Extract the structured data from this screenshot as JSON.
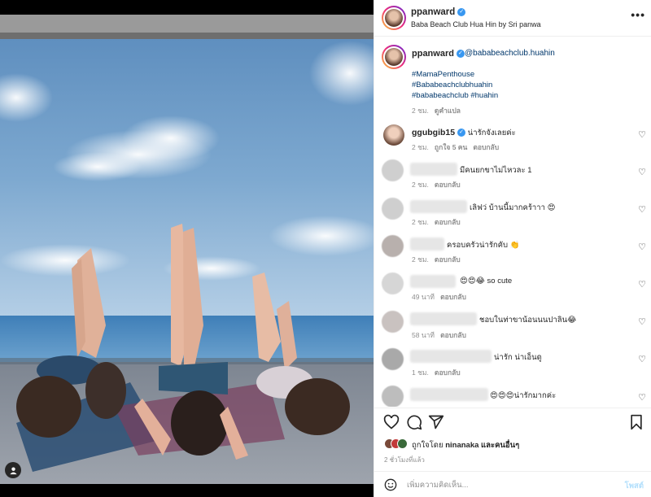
{
  "header": {
    "username": "ppanward",
    "location": "Baba Beach Club Hua Hin by Sri panwa",
    "more_label": "•••"
  },
  "caption": {
    "username": "ppanward",
    "mention": "@bababeachclub.huahin",
    "hashtags": [
      "#MamaPenthouse",
      "#Bababeachclubhuahin",
      "#bababeachclub #huahin"
    ],
    "time": "2 ชม.",
    "translate": "ดูคำแปล"
  },
  "comments": [
    {
      "username": "ggubgib15",
      "text": "น่ารักจังเลยค่ะ",
      "time": "2 ชม.",
      "likes": "ถูกใจ 5 คน",
      "reply": "ตอบกลับ"
    },
    {
      "username": "",
      "text": "มีคนยกขาไม่ไหวละ 1",
      "time": "2 ชม.",
      "reply": "ตอบกลับ"
    },
    {
      "username": "",
      "text": "เลิฟว่ บ้านนี้มากคร้าาา 😍",
      "time": "2 ชม.",
      "reply": "ตอบกลับ"
    },
    {
      "username": "",
      "text": "ครอบครัวน่ารักคับ 👏",
      "time": "2 ชม.",
      "reply": "ตอบกลับ"
    },
    {
      "username": "",
      "text": "😍😍😂 so cute",
      "time": "49 นาที",
      "reply": "ตอบกลับ"
    },
    {
      "username": "",
      "text": "ชอบในท่าขาน้อนนนปาลิน😂",
      "time": "58 นาที",
      "reply": "ตอบกลับ"
    },
    {
      "username": "",
      "text": "น่ารัก น่าเอ็นดู",
      "time": "1 ชม.",
      "reply": "ตอบกลับ"
    },
    {
      "username": "",
      "text": "😍😍😍น่ารักมากค่ะ",
      "time": "",
      "reply": ""
    }
  ],
  "likes": {
    "prefix": "ถูกใจโดย",
    "user": "ninanaka",
    "suffix": "และคนอื่นๆ"
  },
  "time_ago": "2 ชั่วโมงที่แล้ว",
  "comment_input": {
    "placeholder": "เพิ่มความคิดเห็น...",
    "post_label": "โพสต์"
  },
  "colors": {
    "link": "#00376b",
    "verified": "#3897f0",
    "muted": "#8e8e8e",
    "post_disabled": "#b2dffc"
  }
}
